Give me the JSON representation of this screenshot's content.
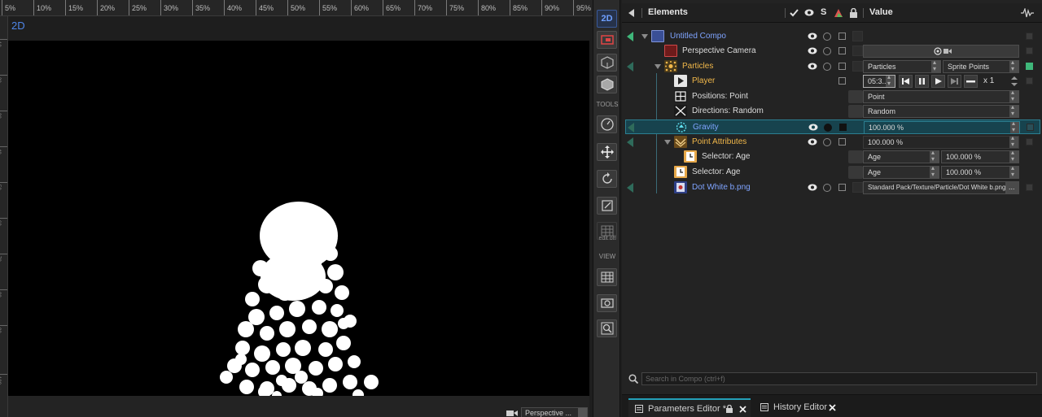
{
  "viewer": {
    "mode_label": "2D",
    "ruler_top": [
      "5%",
      "10%",
      "15%",
      "20%",
      "25%",
      "30%",
      "35%",
      "40%",
      "45%",
      "50%",
      "55%",
      "60%",
      "65%",
      "70%",
      "75%",
      "80%",
      "85%",
      "90%",
      "95%"
    ],
    "ruler_left": [
      "10",
      "20",
      "30",
      "40",
      "50",
      "60",
      "70",
      "80",
      "90",
      "100"
    ],
    "camera_select": "Perspective ..."
  },
  "toolbar": {
    "btn_2d": "2D",
    "tools_label": "TOOLS",
    "edit_off_label": "edit off",
    "view_label": "VIEW"
  },
  "panel": {
    "header_elements": "Elements",
    "header_s": "S",
    "header_value": "Value",
    "rows": [
      {
        "label": "Untitled Compo",
        "color": "blue"
      },
      {
        "label": "Perspective Camera",
        "color": "white"
      },
      {
        "label": "Particles",
        "color": "orange",
        "value1": "Particles",
        "value2": "Sprite Points"
      },
      {
        "label": "Player",
        "color": "orange",
        "time": "05:3...",
        "speed": "x 1"
      },
      {
        "label": "Positions: Point",
        "color": "white",
        "value1": "Point"
      },
      {
        "label": "Directions: Random",
        "color": "white",
        "value1": "Random"
      },
      {
        "label": "Gravity",
        "color": "blue",
        "value1": "100.000 %"
      },
      {
        "label": "Point Attributes",
        "color": "orange",
        "value1": "100.000 %"
      },
      {
        "label": "Selector: Age",
        "color": "white",
        "value1": "Age",
        "value2": "100.000 %"
      },
      {
        "label": "Selector: Age",
        "color": "white",
        "value1": "Age",
        "value2": "100.000 %"
      },
      {
        "label": "Dot White b.png",
        "color": "blue",
        "value1": "Standard Pack/Texture/Particle/Dot White b.png",
        "browse": "..."
      }
    ],
    "search_placeholder": "Search in Compo (ctrl+f)",
    "tabs": [
      {
        "label": "Parameters Editor *"
      },
      {
        "label": "History Editor"
      }
    ]
  },
  "colors": {
    "accent": "#24a0b8",
    "selected_row": "#17434e",
    "blue_text": "#7fa4ff",
    "orange_text": "#f2b84a"
  }
}
